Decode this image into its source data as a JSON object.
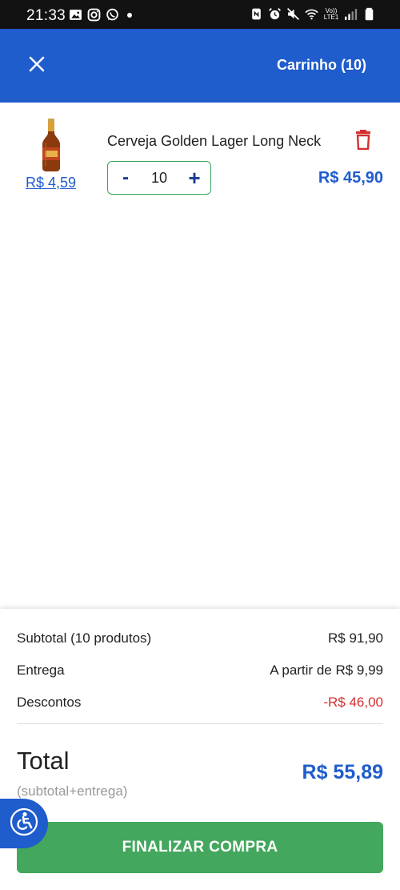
{
  "status_bar": {
    "time": "21:33",
    "left_icons": [
      "gallery-icon",
      "instagram-icon",
      "whatsapp-icon",
      "dot-icon"
    ],
    "right_icons": [
      "nfc-icon",
      "alarm-icon",
      "mute-icon",
      "wifi-icon",
      "volte-lte-icon",
      "signal-icon",
      "battery-icon"
    ],
    "volte_top": "Vo))",
    "volte_bottom": "LTE1"
  },
  "header": {
    "title": "Carrinho (10)",
    "close_icon": "close-icon",
    "background": "#1f5ccc"
  },
  "cart": {
    "items": [
      {
        "name": "Cerveja Golden Lager Long Neck",
        "unit_price": "R$ 4,59",
        "quantity": "10",
        "minus_label": "-",
        "plus_label": "+",
        "line_total": "R$ 45,90",
        "thumbnail_icon": "beer-bottle-icon",
        "delete_icon": "trash-icon"
      }
    ]
  },
  "summary": {
    "subtotal_label": "Subtotal (10 produtos)",
    "subtotal_value": "R$ 91,90",
    "delivery_label": "Entrega",
    "delivery_value": "A partir de R$ 9,99",
    "discount_label": "Descontos",
    "discount_value": "-R$ 46,00",
    "total_label": "Total",
    "total_sub": "(subtotal+entrega)",
    "total_value": "R$ 55,89"
  },
  "checkout": {
    "label": "FINALIZAR COMPRA",
    "color": "#43a75d"
  },
  "accessibility": {
    "icon": "accessibility-icon"
  },
  "colors": {
    "primary": "#1f5ccc",
    "accent_green": "#43a75d",
    "discount_red": "#d32f2f"
  }
}
